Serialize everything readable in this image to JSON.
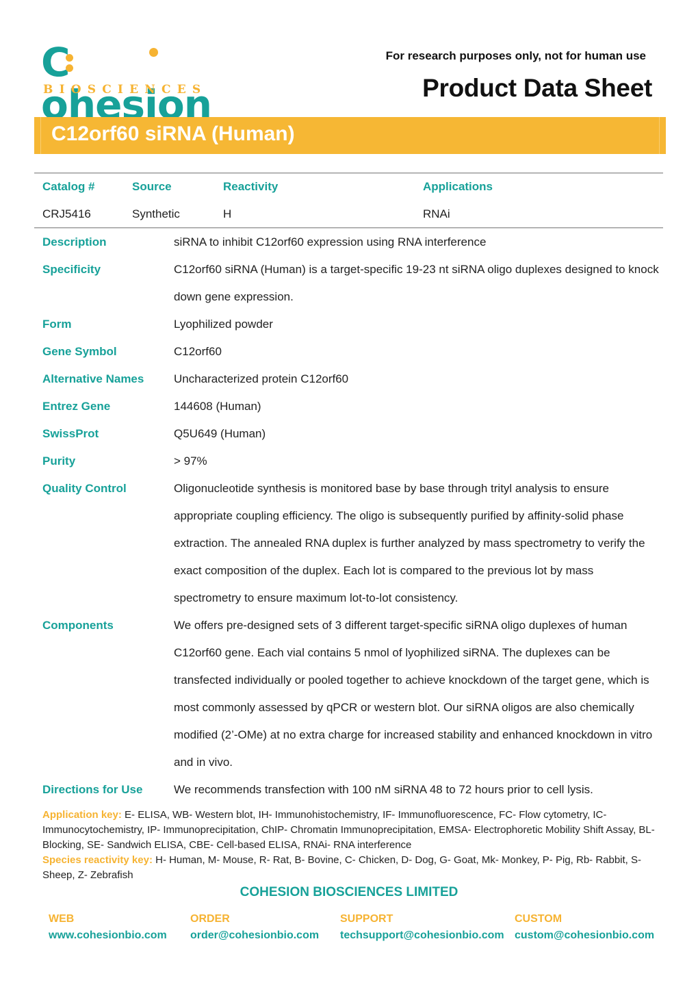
{
  "header": {
    "logo_word": "ohesion",
    "logo_c": "C",
    "logo_sub": "BIOSCIENCES",
    "research_note": "For research purposes only, not for human use",
    "sheet_title": "Product Data Sheet"
  },
  "banner": {
    "title": "C12orf60 siRNA (Human)"
  },
  "summary_table": {
    "headers": [
      "Catalog #",
      "Source",
      "Reactivity",
      "Applications"
    ],
    "values": [
      "CRJ5416",
      "Synthetic",
      "H",
      "RNAi"
    ]
  },
  "details": [
    {
      "label": "Description",
      "value": "siRNA to inhibit C12orf60 expression using RNA interference"
    },
    {
      "label": "Specificity",
      "value": "C12orf60 siRNA (Human) is a target-specific 19-23 nt siRNA oligo duplexes designed to knock down gene expression."
    },
    {
      "label": "Form",
      "value": "Lyophilized powder"
    },
    {
      "label": "Gene Symbol",
      "value": "C12orf60"
    },
    {
      "label": "Alternative Names",
      "value": "Uncharacterized protein C12orf60"
    },
    {
      "label": "Entrez Gene",
      "value": "144608 (Human)"
    },
    {
      "label": "SwissProt",
      "value": "Q5U649 (Human)"
    },
    {
      "label": "Purity",
      "value": "> 97%"
    },
    {
      "label": "Quality Control",
      "value": "Oligonucleotide synthesis is monitored base by base through trityl analysis to ensure appropriate coupling efficiency. The oligo is subsequently purified by affinity-solid phase extraction. The annealed RNA duplex is further analyzed by mass spectrometry to verify the exact composition of the duplex. Each lot is compared to the previous lot by mass spectrometry to ensure maximum lot-to-lot consistency."
    },
    {
      "label": "Components",
      "value": "We offers pre-designed sets of 3 different target-specific siRNA oligo duplexes of human C12orf60 gene. Each vial contains 5 nmol of lyophilized siRNA. The duplexes can be transfected individually or pooled together to achieve knockdown of the target gene, which is most commonly assessed by qPCR or western blot. Our siRNA oligos are also chemically modified (2’-OMe) at no extra charge for increased stability and enhanced knockdown in vitro and in vivo."
    },
    {
      "label": "Directions for Use",
      "value": "We recommends transfection with 100 nM siRNA 48 to 72 hours prior to cell lysis."
    }
  ],
  "keys": {
    "application_label": "Application key:",
    "application_text": " E- ELISA, WB- Western blot, IH- Immunohistochemistry, IF- Immunofluorescence, FC- Flow cytometry, IC- Immunocytochemistry, IP- Immunoprecipitation, ChIP- Chromatin Immunoprecipitation, EMSA- Electrophoretic Mobility Shift Assay, BL- Blocking, SE- Sandwich ELISA, CBE- Cell-based ELISA, RNAi- RNA interference",
    "species_label": "Species reactivity key:",
    "species_text": " H- Human, M- Mouse, R- Rat, B- Bovine, C- Chicken, D- Dog, G- Goat, Mk- Monkey, P- Pig, Rb- Rabbit, S- Sheep, Z- Zebrafish"
  },
  "footer": {
    "company": "COHESION BIOSCIENCES LIMITED",
    "contacts": [
      {
        "label": "WEB",
        "value": "www.cohesionbio.com"
      },
      {
        "label": "ORDER",
        "value": "order@cohesionbio.com"
      },
      {
        "label": "SUPPORT",
        "value": "techsupport@cohesionbio.com"
      },
      {
        "label": "CUSTOM",
        "value": "custom@cohesionbio.com"
      }
    ]
  },
  "colors": {
    "brand_teal": "#17a199",
    "brand_orange": "#f6b734"
  }
}
